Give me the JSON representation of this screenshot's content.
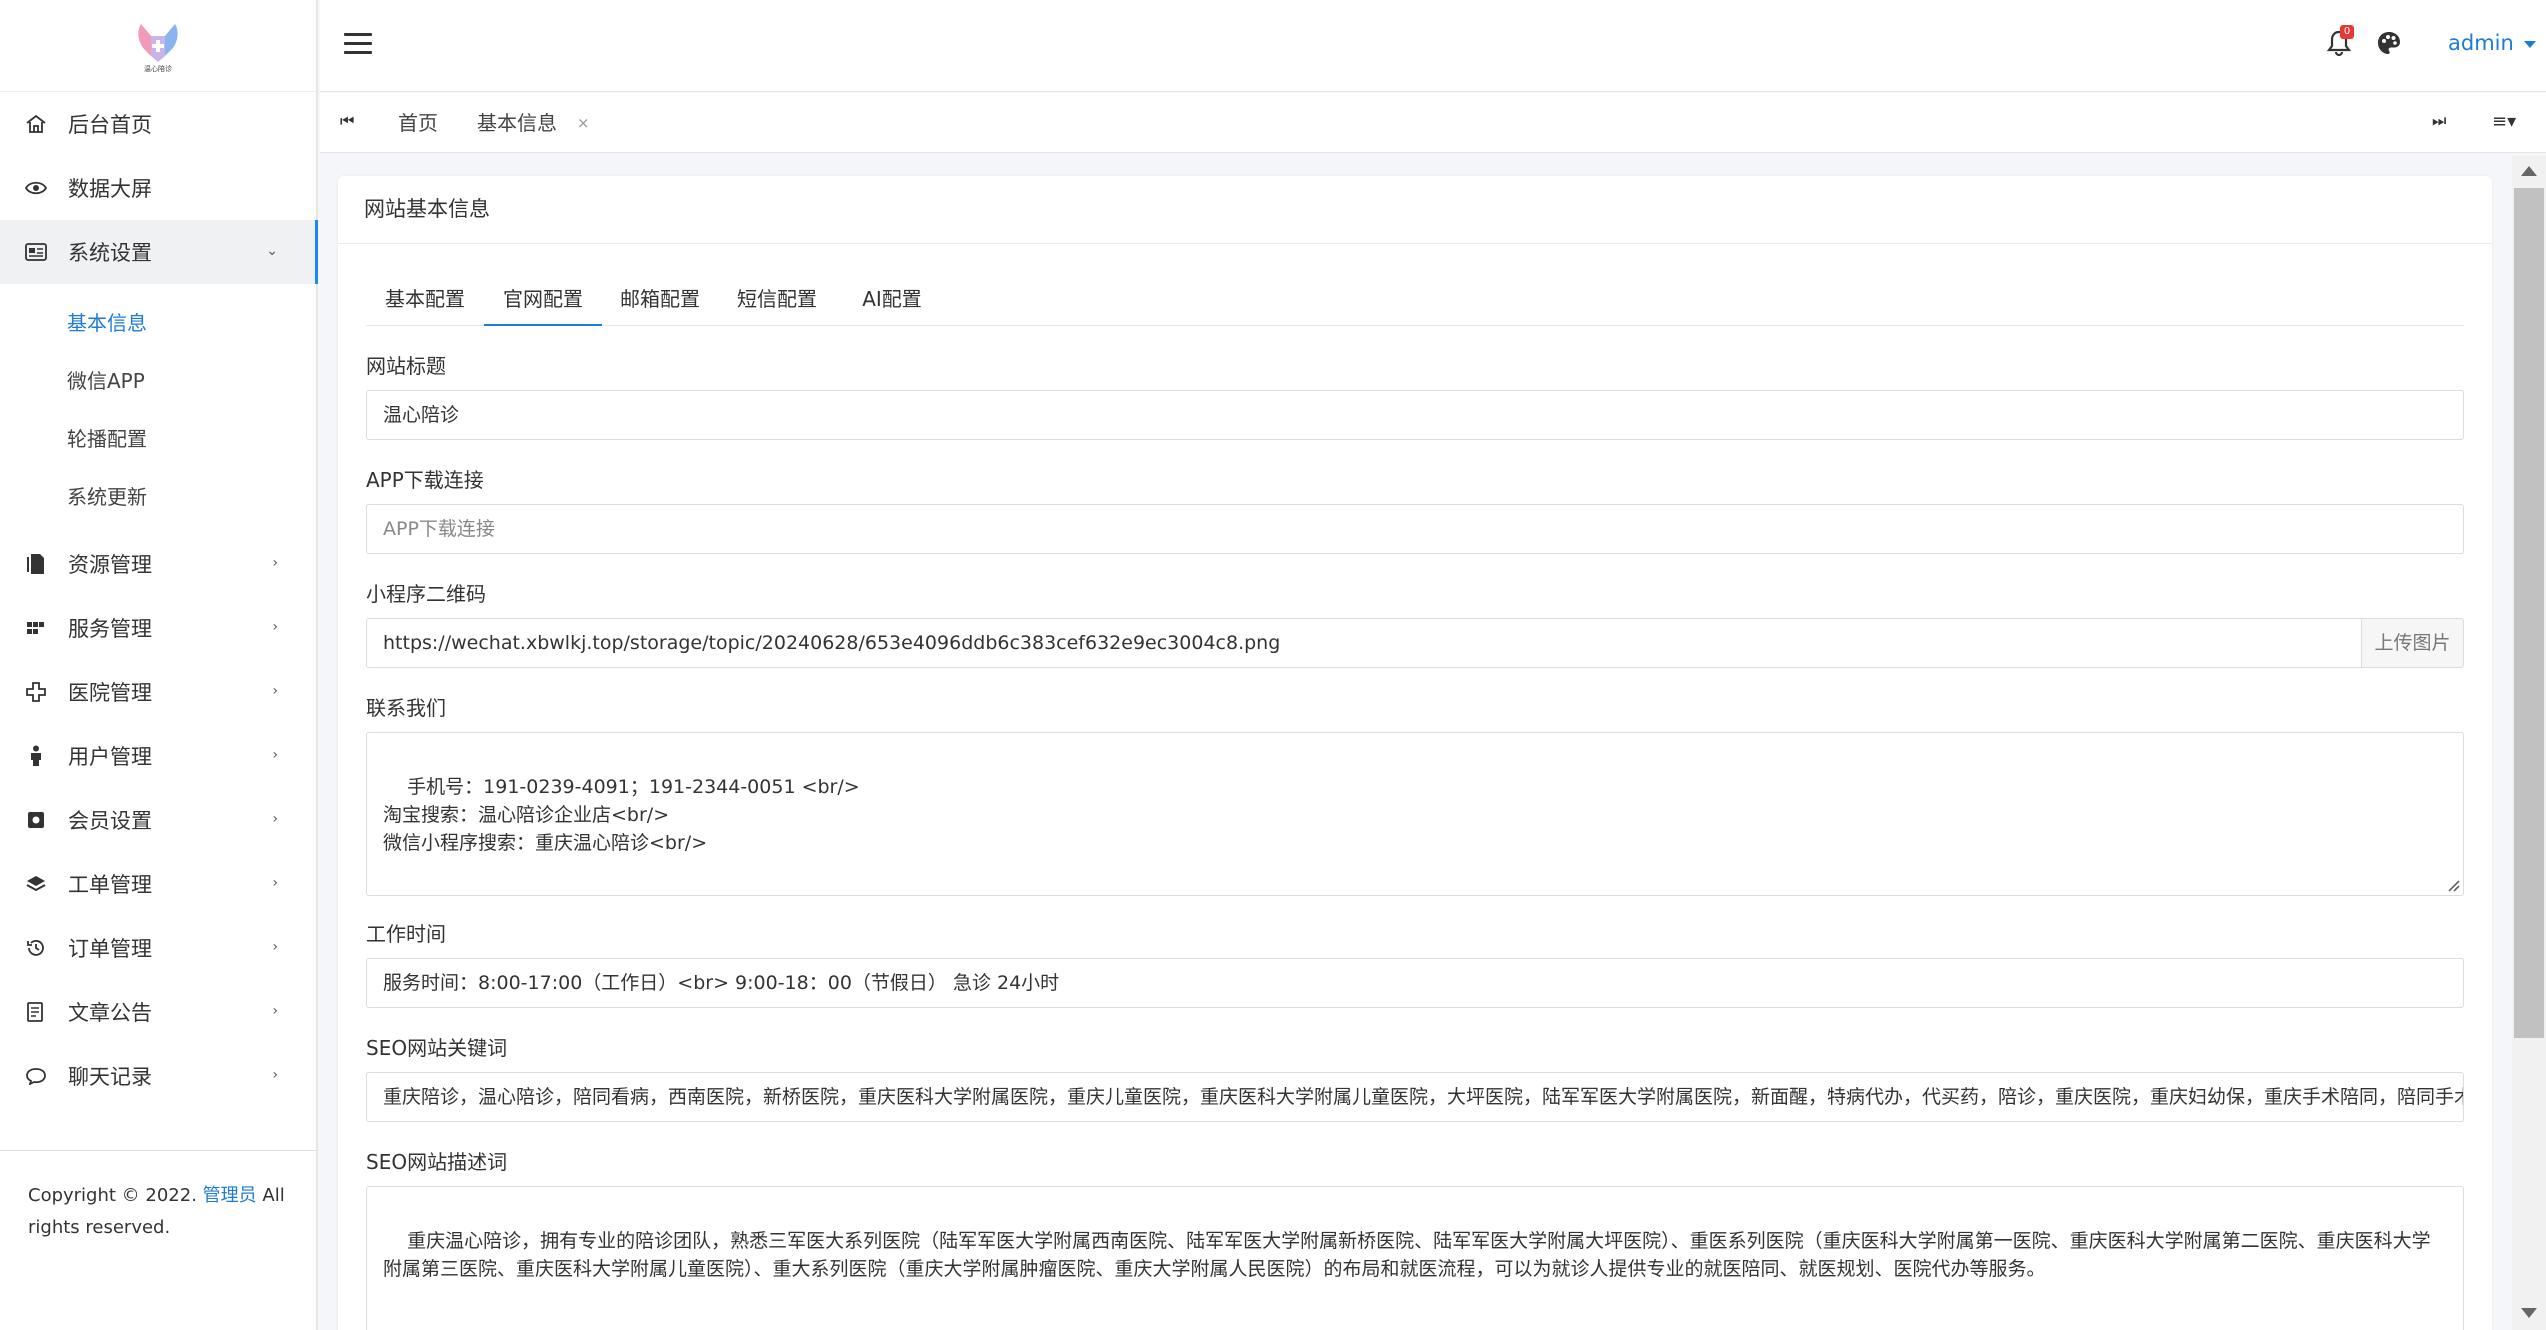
{
  "logo": {
    "text": "温心陪诊"
  },
  "sidebar": {
    "items": [
      {
        "label": "后台首页",
        "icon": "home-icon"
      },
      {
        "label": "数据大屏",
        "icon": "eye-icon"
      },
      {
        "label": "系统设置",
        "icon": "settings-card-icon",
        "expanded": true
      },
      {
        "label": "资源管理",
        "icon": "file-icon"
      },
      {
        "label": "服务管理",
        "icon": "grid-icon"
      },
      {
        "label": "医院管理",
        "icon": "plus-icon"
      },
      {
        "label": "用户管理",
        "icon": "user-icon"
      },
      {
        "label": "会员设置",
        "icon": "badge-icon"
      },
      {
        "label": "工单管理",
        "icon": "layers-icon"
      },
      {
        "label": "订单管理",
        "icon": "history-icon"
      },
      {
        "label": "文章公告",
        "icon": "article-icon"
      },
      {
        "label": "聊天记录",
        "icon": "chat-icon"
      }
    ],
    "sub_items": [
      {
        "label": "基本信息",
        "active": true
      },
      {
        "label": "微信APP"
      },
      {
        "label": "轮播配置"
      },
      {
        "label": "系统更新"
      }
    ],
    "copyright_prefix": "Copyright © 2022. ",
    "copyright_link": "管理员",
    "copyright_suffix": " All rights reserved."
  },
  "header": {
    "notification_count": "0",
    "user": "admin"
  },
  "tabs": {
    "home": "首页",
    "current": "基本信息",
    "close": "×"
  },
  "card": {
    "title": "网站基本信息",
    "form_tabs": [
      "基本配置",
      "官网配置",
      "邮箱配置",
      "短信配置",
      "AI配置"
    ],
    "active_tab": "官网配置"
  },
  "form": {
    "site_title_label": "网站标题",
    "site_title_value": "温心陪诊",
    "app_link_label": "APP下载连接",
    "app_link_placeholder": "APP下载连接",
    "qrcode_label": "小程序二维码",
    "qrcode_value": "https://wechat.xbwlkj.top/storage/topic/20240628/653e4096ddb6c383cef632e9ec3004c8.png",
    "upload_button": "上传图片",
    "contact_label": "联系我们",
    "contact_value": "手机号：191-0239-4091；191-2344-0051 <br/>\n淘宝搜索：温心陪诊企业店<br/>\n微信小程序搜索：重庆温心陪诊<br/>",
    "hours_label": "工作时间",
    "hours_value": "服务时间：8:00-17:00（工作日）<br>  9:00-18：00（节假日） 急诊 24小时",
    "seo_keywords_label": "SEO网站关键词",
    "seo_keywords_value": "重庆陪诊，温心陪诊，陪同看病，西南医院，新桥医院，重庆医科大学附属医院，重庆儿童医院，重庆医科大学附属儿童医院，大坪医院，陆军军医大学附属医院，新面醒，特病代办，代买药，陪诊，重庆医院，重庆妇幼保，重庆手术陪同，陪同手术，",
    "seo_desc_label": "SEO网站描述词",
    "seo_desc_value": "重庆温心陪诊，拥有专业的陪诊团队，熟悉三军医大系列医院（陆军军医大学附属西南医院、陆军军医大学附属新桥医院、陆军军医大学附属大坪医院）、重医系列医院（重庆医科大学附属第一医院、重庆医科大学附属第二医院、重庆医科大学附属第三医院、重庆医科大学附属儿童医院）、重大系列医院（重庆大学附属肿瘤医院、重庆大学附属人民医院）的布局和就医流程，可以为就诊人提供专业的就医陪同、就医规划、医院代办等服务。"
  },
  "colors": {
    "accent": "#1e7bd6",
    "badge": "#e53935"
  }
}
